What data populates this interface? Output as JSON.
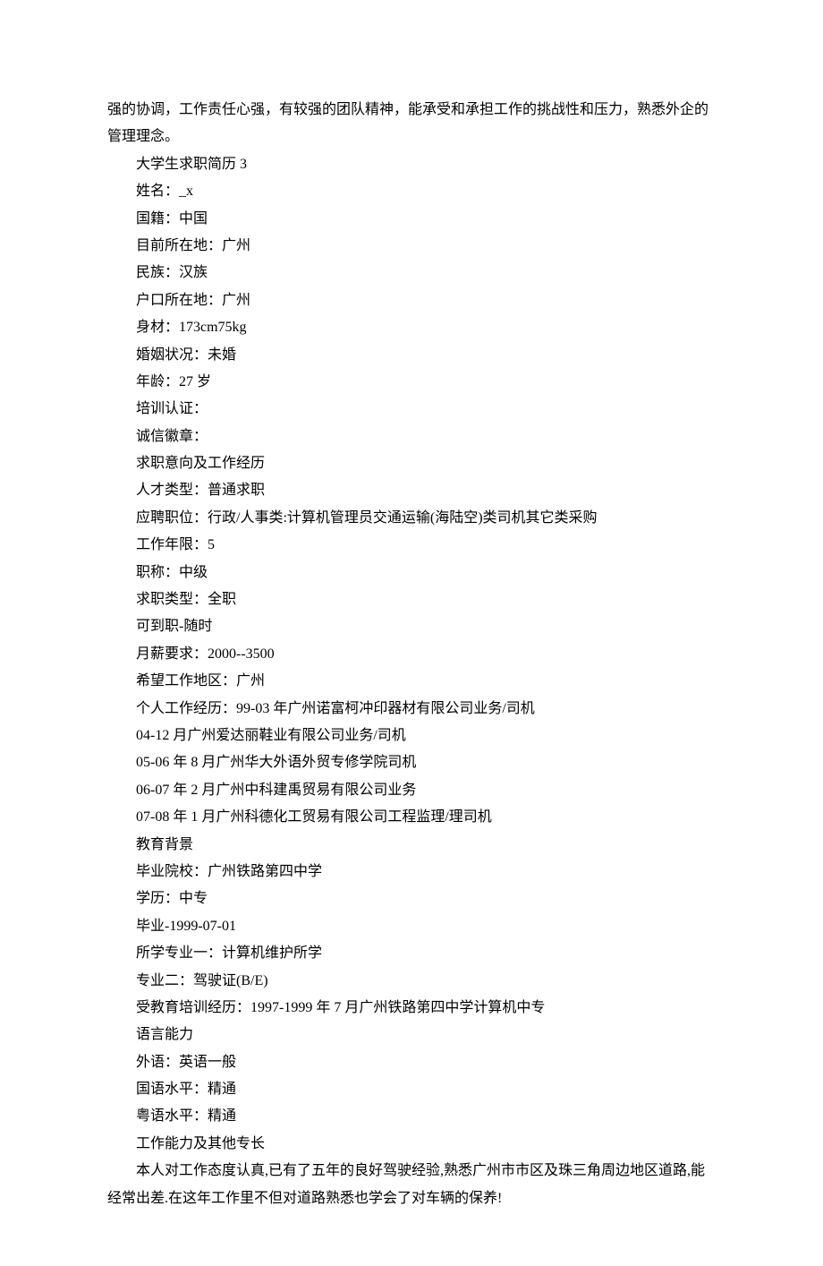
{
  "lines": [
    {
      "indent": false,
      "text": "强的协调，工作责任心强，有较强的团队精神，能承受和承担工作的挑战性和压力，熟悉外企的管理理念。"
    },
    {
      "indent": true,
      "text": "大学生求职简历 3"
    },
    {
      "indent": true,
      "text": "姓名：_x"
    },
    {
      "indent": true,
      "text": "国籍：中国"
    },
    {
      "indent": true,
      "text": "目前所在地：广州"
    },
    {
      "indent": true,
      "text": "民族：汉族"
    },
    {
      "indent": true,
      "text": "户口所在地：广州"
    },
    {
      "indent": true,
      "text": "身材：173cm75kg"
    },
    {
      "indent": true,
      "text": "婚姻状况：未婚"
    },
    {
      "indent": true,
      "text": "年龄：27 岁"
    },
    {
      "indent": true,
      "text": "培训认证："
    },
    {
      "indent": true,
      "text": "诚信徽章："
    },
    {
      "indent": true,
      "text": "求职意向及工作经历"
    },
    {
      "indent": true,
      "text": "人才类型：普通求职"
    },
    {
      "indent": true,
      "text": "应聘职位：行政/人事类:计算机管理员交通运输(海陆空)类司机其它类采购"
    },
    {
      "indent": true,
      "text": "工作年限：5"
    },
    {
      "indent": true,
      "text": "职称：中级"
    },
    {
      "indent": true,
      "text": "求职类型：全职"
    },
    {
      "indent": true,
      "text": "可到职-随时"
    },
    {
      "indent": true,
      "text": "月薪要求：2000--3500"
    },
    {
      "indent": true,
      "text": "希望工作地区：广州"
    },
    {
      "indent": true,
      "text": "个人工作经历：99-03 年广州诺富柯冲印器材有限公司业务/司机"
    },
    {
      "indent": true,
      "text": "04-12 月广州爱达丽鞋业有限公司业务/司机"
    },
    {
      "indent": true,
      "text": "05-06 年 8 月广州华大外语外贸专修学院司机"
    },
    {
      "indent": true,
      "text": "06-07 年 2 月广州中科建禹贸易有限公司业务"
    },
    {
      "indent": true,
      "text": "07-08 年 1 月广州科德化工贸易有限公司工程监理/理司机"
    },
    {
      "indent": true,
      "text": "教育背景"
    },
    {
      "indent": true,
      "text": "毕业院校：广州铁路第四中学"
    },
    {
      "indent": true,
      "text": "学历：中专"
    },
    {
      "indent": true,
      "text": "毕业-1999-07-01"
    },
    {
      "indent": true,
      "text": "所学专业一：计算机维护所学"
    },
    {
      "indent": true,
      "text": "专业二：驾驶证(B/E)"
    },
    {
      "indent": true,
      "text": "受教育培训经历：1997-1999 年 7 月广州铁路第四中学计算机中专"
    },
    {
      "indent": true,
      "text": "语言能力"
    },
    {
      "indent": true,
      "text": "外语：英语一般"
    },
    {
      "indent": true,
      "text": "国语水平：精通"
    },
    {
      "indent": true,
      "text": "粤语水平：精通"
    },
    {
      "indent": true,
      "text": "工作能力及其他专长"
    },
    {
      "indent": true,
      "text": "本人对工作态度认真,已有了五年的良好驾驶经验,熟悉广州市市区及珠三角周边地区道路,能经常出差.在这年工作里不但对道路熟悉也学会了对车辆的保养!"
    }
  ]
}
